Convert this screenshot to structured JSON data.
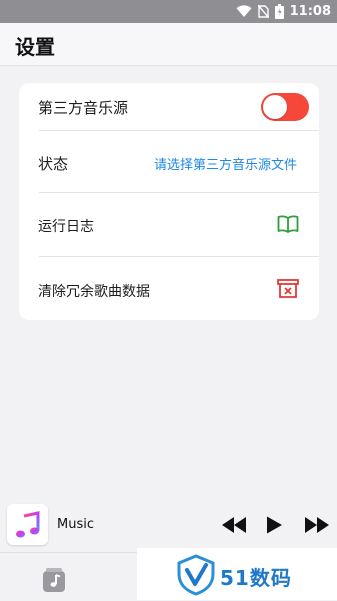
{
  "status_bar": {
    "time": "11:08"
  },
  "header": {
    "title": "设置"
  },
  "settings": {
    "third_party_source": {
      "label": "第三方音乐源",
      "enabled": true
    },
    "status": {
      "label": "状态",
      "value": "请选择第三方音乐源文件"
    },
    "run_log": {
      "label": "运行日志"
    },
    "clear_redundant": {
      "label": "清除冗余歌曲数据"
    }
  },
  "player": {
    "track_title": "Music"
  },
  "watermark": {
    "text": "51数码"
  },
  "colors": {
    "accent_red": "#f5483b",
    "link_blue": "#1e88e5",
    "icon_green": "#2e9e3f",
    "icon_red": "#e53935"
  },
  "icons": {
    "wifi": "wifi-icon",
    "no_sim": "no-sim-icon",
    "battery": "battery-icon",
    "book": "book-icon",
    "delete": "delete-box-icon",
    "music_app": "music-note-icon",
    "rewind": "rewind-icon",
    "play": "play-icon",
    "fast_forward": "fast-forward-icon",
    "tab_music": "music-library-icon",
    "watermark_logo": "shield-logo-icon"
  }
}
